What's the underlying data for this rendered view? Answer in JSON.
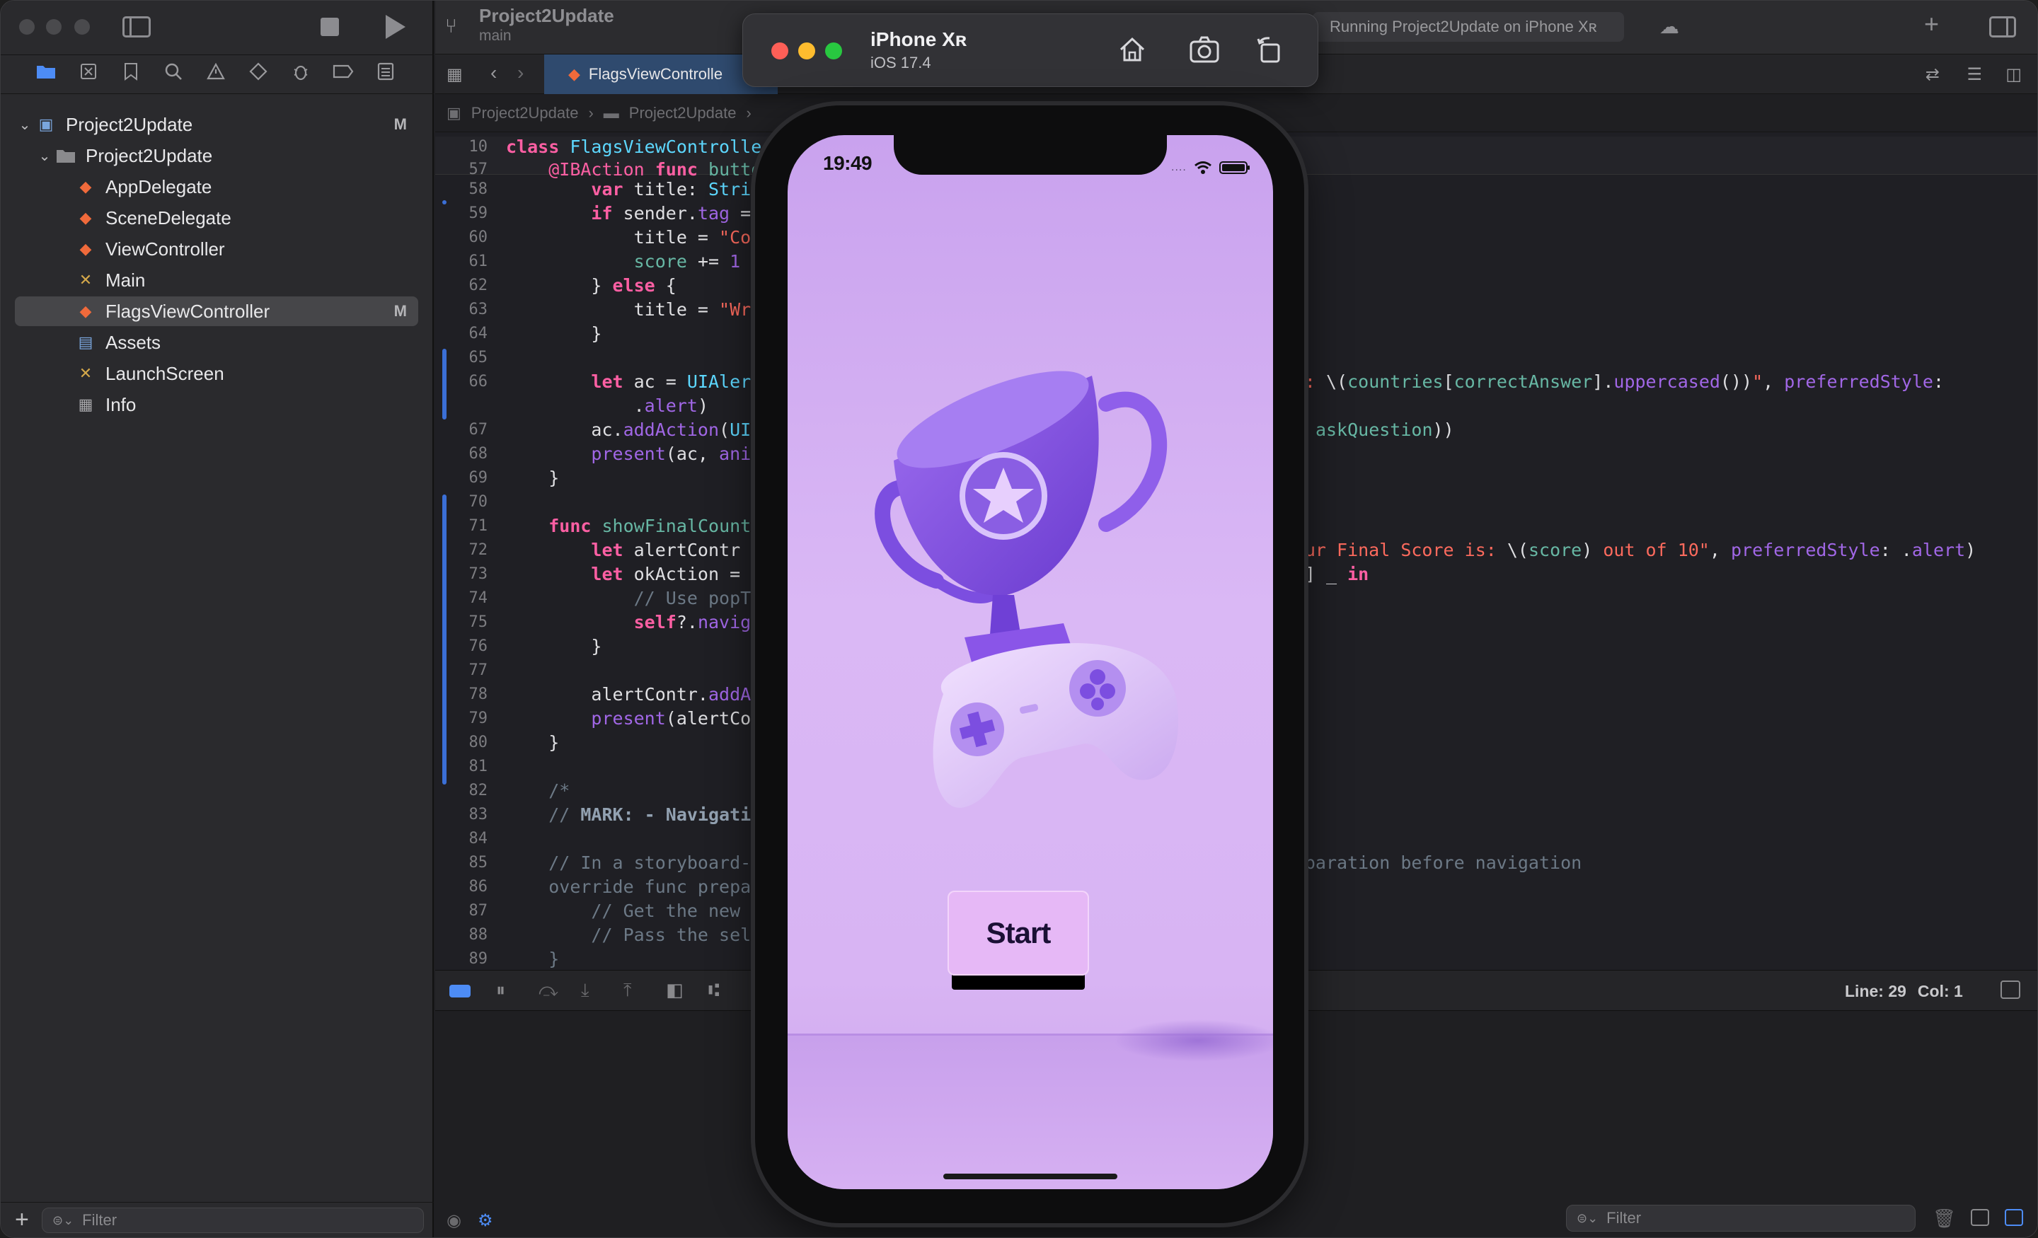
{
  "project": {
    "name": "Project2Update",
    "branch": "main",
    "status": "Running Project2Update on iPhone Xʀ"
  },
  "navigator": {
    "items": [
      {
        "label": "Project2Update",
        "badge": "M",
        "icon": "project-icon"
      },
      {
        "label": "Project2Update",
        "badge": "",
        "icon": "folder-icon"
      },
      {
        "label": "AppDelegate",
        "badge": "",
        "icon": "swift-file-icon"
      },
      {
        "label": "SceneDelegate",
        "badge": "",
        "icon": "swift-file-icon"
      },
      {
        "label": "ViewController",
        "badge": "",
        "icon": "swift-file-icon"
      },
      {
        "label": "Main",
        "badge": "",
        "icon": "storyboard-icon"
      },
      {
        "label": "FlagsViewController",
        "badge": "M",
        "icon": "swift-file-icon"
      },
      {
        "label": "Assets",
        "badge": "",
        "icon": "asset-catalog-icon"
      },
      {
        "label": "LaunchScreen",
        "badge": "",
        "icon": "storyboard-icon"
      },
      {
        "label": "Info",
        "badge": "",
        "icon": "plist-icon"
      }
    ],
    "filter_placeholder": "Filter"
  },
  "editor": {
    "tab_label": "FlagsViewControlle",
    "jumpbar": [
      "Project2Update",
      "Project2Update"
    ],
    "status": {
      "line": "Line: 29",
      "col": "Col: 1"
    }
  },
  "console": {
    "filter_placeholder": "Filter"
  },
  "simulator": {
    "device": "iPhone Xʀ",
    "os": "iOS 17.4",
    "time": "19:49",
    "start_label": "Start"
  },
  "colors": {
    "accent": "#4d8cf5",
    "screen_bg": "#d4aef2",
    "button_bg": "#e6b8f6"
  }
}
